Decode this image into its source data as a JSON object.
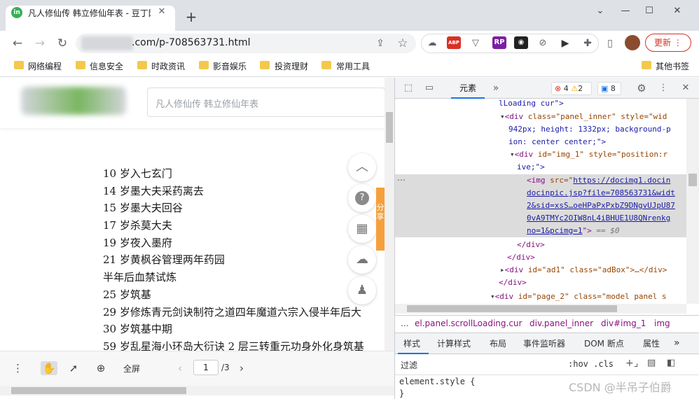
{
  "browser": {
    "tab_title": "凡人修仙传 韩立修仙年表 - 豆丁网",
    "tab_favicon": "in",
    "url": ".com/p-708563731.html",
    "update_button": "更新",
    "ext_abp": "ABP",
    "ext_rp": "RP"
  },
  "bookmarks": [
    "网络编程",
    "信息安全",
    "时政资讯",
    "影音娱乐",
    "投资理财",
    "常用工具"
  ],
  "other_bookmarks": "其他书签",
  "page": {
    "search_placeholder": "凡人修仙传  韩立修仙年表",
    "lines": [
      "10 岁入七玄门",
      "14 岁墨大夫采药离去",
      "15 岁墨大夫回谷",
      "17 岁杀莫大夫",
      "19 岁夜入墨府",
      "21 岁黄枫谷管理两年药园",
      "半年后血禁试炼",
      "25 岁筑基",
      "29 岁修炼青元剑诀制符之道四年魔道六宗入侵半年后大",
      "30 岁筑基中期",
      "59 岁乱星海小环岛大衍诀 2 层三转重元功身外化身筑基"
    ],
    "orange_tab_text": "分享",
    "pdf_fullscreen": "全屏",
    "pdf_page": "1",
    "pdf_total": "/3"
  },
  "devtools": {
    "elements_tab": "元素",
    "errors": "4",
    "warnings": "2",
    "messages": "8",
    "dom": {
      "l1": "lLoading cur\">",
      "l2_tag": "<div ",
      "l2_attr": "class=\"panel_inner\" style=\"wid",
      "l3": "942px; height: 1332px; background-p",
      "l4": "ion: center center;\">",
      "l5_tag": "<div ",
      "l5_attr": "id=\"img_1\" style=\"position:r",
      "l6": "ive;\">",
      "l7_tag": "<img ",
      "l7_attr": "src=\"",
      "l7_link": "https://docimg1.docin",
      "l8": "docinpic.jsp?file=708563731&widt",
      "l9": "2&sid=xsS…oeHPaPxPxbZ9DNgvUJpU87",
      "l10": "0vA9TMYc2OIW8nL4iBHUE1U8QNrenkg",
      "l11": "no=1&pcimg=1",
      "l11_tail": "\">",
      "l11_eq": "== $0",
      "l12": "</div>",
      "l13": "</div>",
      "l14_tag": "<div ",
      "l14_attr": "id=\"ad1\" class=\"adBox\">…</div>",
      "l15": "</div>",
      "l16_tag": "<div ",
      "l16_attr": "id=\"page_2\" class=\"model panel s"
    },
    "breadcrumbs": [
      "...",
      "el.panel.scrollLoading.cur",
      "div.panel_inner",
      "div#img_1",
      "img"
    ],
    "style_tabs": [
      "样式",
      "计算样式",
      "布局",
      "事件监听器",
      "DOM 断点",
      "属性"
    ],
    "filter_label": "过滤",
    "filter_options": ":hov  .cls",
    "element_style": "element.style {",
    "element_style_close": "}"
  },
  "watermark": "CSDN @半吊子伯爵",
  "colors": {
    "accent": "#1a73e8",
    "update": "#d93025",
    "orange": "#f5a03c",
    "favicon": "#35b056"
  }
}
